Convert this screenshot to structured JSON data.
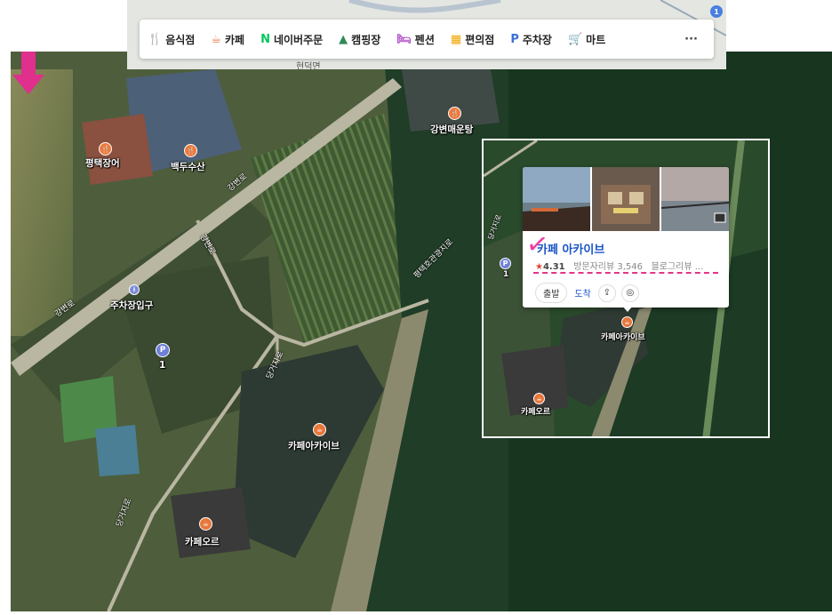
{
  "toolbar": {
    "categories": [
      {
        "icon": "fork-knife-icon",
        "glyph": "🍴",
        "color": "#f07a3a",
        "label": "음식점"
      },
      {
        "icon": "coffee-cup-icon",
        "glyph": "☕",
        "color": "#e8763a",
        "label": "카페"
      },
      {
        "icon": "naver-n-icon",
        "glyph": "N",
        "color": "#03c75a",
        "label": "네이버주문"
      },
      {
        "icon": "tent-icon",
        "glyph": "▲",
        "color": "#2e8b57",
        "label": "캠핑장"
      },
      {
        "icon": "bed-icon",
        "glyph": "🛏",
        "color": "#b04dc8",
        "label": "펜션"
      },
      {
        "icon": "store-icon",
        "glyph": "▦",
        "color": "#f0a500",
        "label": "편의점"
      },
      {
        "icon": "parking-icon",
        "glyph": "P",
        "color": "#3b6fd8",
        "label": "주차장"
      },
      {
        "icon": "cart-icon",
        "glyph": "🛒",
        "color": "#f0a500",
        "label": "마트"
      }
    ],
    "more": "···",
    "city": "현덕면",
    "badge": "1"
  },
  "map": {
    "places": {
      "pyeongtaek_eel": "평택장어",
      "baekdu": "백두수산",
      "gangbyeon": "강변매운탕",
      "parking_entrance": "주차장입구",
      "parking_num": "1",
      "cafe_archive": "카페아카이브",
      "cafe_oreu": "카페오르"
    },
    "roads": {
      "r1": "강변로",
      "r2": "강변로",
      "r3": "강변로",
      "r4": "당거지로",
      "r5": "당거지로",
      "r6": "평택호관광지로"
    }
  },
  "inset": {
    "card": {
      "title": "카페 아카이브",
      "rating": "4.31",
      "visitor_reviews": "방문자리뷰 3,546",
      "blog_reviews": "블로그리뷰 ...",
      "depart": "출발",
      "arrive": "도착"
    },
    "labels": {
      "cafe_archive": "카페아카이브",
      "cafe_oreu": "카페오르",
      "road": "평택호관광지로",
      "road2": "당거지로",
      "parking_num": "1"
    }
  },
  "colors": {
    "accent_pink": "#e6338a",
    "title_blue": "#1a55c9",
    "star_red": "#e8433a"
  }
}
